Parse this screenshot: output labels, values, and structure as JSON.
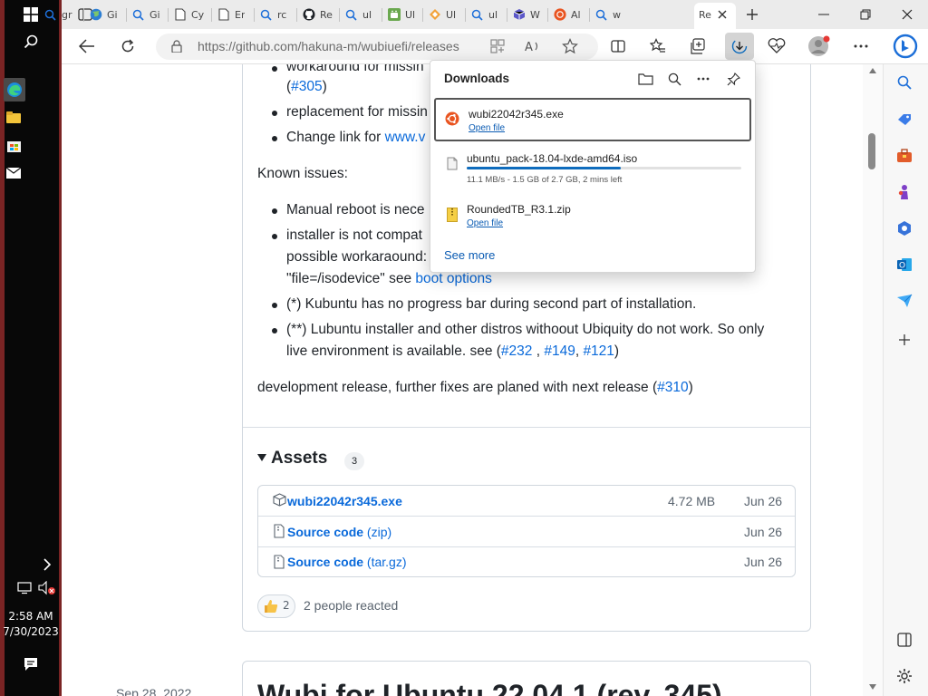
{
  "taskbar": {
    "time": "2:58 AM",
    "date": "7/30/2023"
  },
  "tabs": [
    {
      "label": "gr",
      "icon": "search-icon"
    },
    {
      "label": "Gi",
      "icon": "globe-icon"
    },
    {
      "label": "Gi",
      "icon": "search-icon"
    },
    {
      "label": "Cy",
      "icon": "document-icon"
    },
    {
      "label": "Er",
      "icon": "document-icon"
    },
    {
      "label": "rc",
      "icon": "search-icon"
    },
    {
      "label": "Re",
      "icon": "github-icon"
    },
    {
      "label": "ul",
      "icon": "search-icon"
    },
    {
      "label": "Ul",
      "icon": "android-icon"
    },
    {
      "label": "Ul",
      "icon": "diamond-icon"
    },
    {
      "label": "ul",
      "icon": "search-icon"
    },
    {
      "label": "W",
      "icon": "cube-icon"
    },
    {
      "label": "Al",
      "icon": "ubuntu-icon"
    },
    {
      "label": "w",
      "icon": "search-icon"
    }
  ],
  "active_tab": {
    "label": "Re"
  },
  "address_bar": {
    "url": "https://github.com/hakuna-m/wubiuefi/releases"
  },
  "release_notes": {
    "fixes": [
      {
        "text": "workaround for missin"
      },
      {
        "text_link": "#305"
      },
      {
        "text": "replacement for missin"
      },
      {
        "text": "Change link for ",
        "link": "www.v"
      }
    ],
    "known_issues_label": "Known issues:",
    "issues": [
      {
        "text": "Manual reboot is nece"
      },
      {
        "text": "installer is not compat"
      },
      {
        "text": "possible workaraound:"
      },
      {
        "text": "\"file=/isodevice\" see ",
        "link": "boot options"
      },
      {
        "text": "(*) Kubuntu has no progress bar during second part of installation."
      },
      {
        "text": "(**) Lubuntu installer and other distros withoout Ubiquity do not work. So only"
      },
      {
        "text": "live environment is available. see (",
        "links": [
          "#232",
          "#149",
          "#121"
        ]
      }
    ],
    "dev_release_text": "development release, further fixes are planed with next release (",
    "dev_release_link": "#310",
    "dev_release_close": ")"
  },
  "assets": {
    "title": "Assets",
    "count": "3",
    "files": [
      {
        "name": "wubi22042r345.exe",
        "ext": "",
        "size": "4.72 MB",
        "date": "Jun 26"
      },
      {
        "name": "Source code",
        "ext": "(zip)",
        "size": "",
        "date": "Jun 26"
      },
      {
        "name": "Source code",
        "ext": "(tar.gz)",
        "size": "",
        "date": "Jun 26"
      }
    ]
  },
  "reactions": {
    "count": "2",
    "text": "2 people reacted"
  },
  "next_release": {
    "date": "Sep 28, 2022",
    "title": "Wubi for Ubuntu 22.04.1 (rev. 345)"
  },
  "downloads_panel": {
    "title": "Downloads",
    "items": [
      {
        "name": "wubi22042r345.exe",
        "action": "Open file",
        "icon": "ubuntu-icon"
      },
      {
        "name": "ubuntu_pack-18.04-lxde-amd64.iso",
        "status": "11.1 MB/s - 1.5 GB of 2.7 GB, 2 mins left",
        "progress": 0.56,
        "icon": "file-icon"
      },
      {
        "name": "RoundedTB_R3.1.zip",
        "action": "Open file",
        "icon": "zip-icon"
      }
    ],
    "see_more": "See more"
  },
  "colors": {
    "link": "#0969da",
    "taskbar_accent": "#7a2424",
    "progress": "#0f6cbd"
  }
}
